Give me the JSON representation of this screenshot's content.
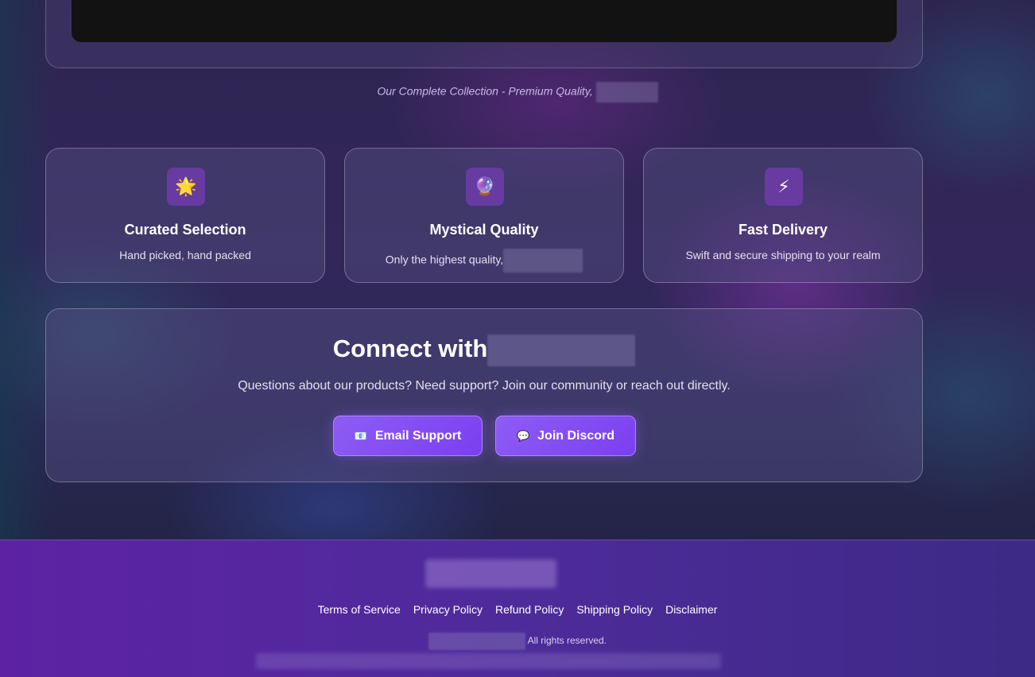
{
  "caption": {
    "text": "Our Complete Collection - Premium Quality,"
  },
  "features": [
    {
      "icon": "🌟",
      "icon_name": "glowing-star-icon",
      "title": "Curated Selection",
      "desc": "Hand picked, hand packed"
    },
    {
      "icon": "🔮",
      "icon_name": "crystal-ball-icon",
      "title": "Mystical Quality",
      "desc": "Only the highest quality,"
    },
    {
      "icon": "⚡",
      "icon_name": "lightning-icon",
      "title": "Fast Delivery",
      "desc": "Swift and secure shipping to your realm"
    }
  ],
  "connect": {
    "title": "Connect with",
    "subtitle": "Questions about our products? Need support? Join our community or reach out directly.",
    "email_icon": "📧",
    "email_label": "Email Support",
    "discord_icon": "💬",
    "discord_label": "Join Discord"
  },
  "footer": {
    "links": [
      "Terms of Service",
      "Privacy Policy",
      "Refund Policy",
      "Shipping Policy",
      "Disclaimer"
    ],
    "copyright": "All rights reserved."
  },
  "colors": {
    "accent": "#8b5cf6",
    "footer_bg": "#5d22a4"
  }
}
